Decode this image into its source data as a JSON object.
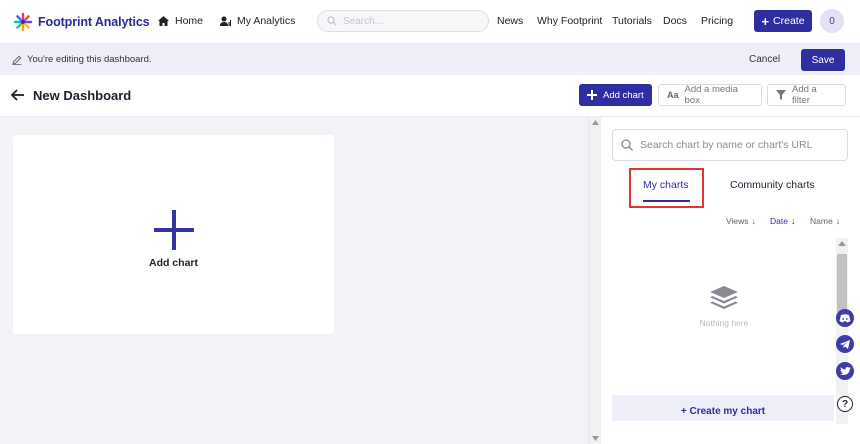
{
  "nav": {
    "brand": "Footprint Analytics",
    "home": "Home",
    "my_analytics": "My Analytics",
    "search_placeholder": "Search...",
    "links": [
      "News",
      "Why Footprint",
      "Tutorials",
      "Docs",
      "Pricing"
    ],
    "create": "Create",
    "avatar_initial": "0"
  },
  "banner": {
    "text": "You're editing this dashboard.",
    "cancel": "Cancel",
    "save": "Save"
  },
  "titlebar": {
    "title": "New Dashboard",
    "add_chart": "Add chart",
    "add_media": "Add a media box",
    "add_filter": "Add a filter"
  },
  "canvas": {
    "add_chart_label": "Add chart"
  },
  "panel": {
    "search_placeholder": "Search chart by name or chart's URL",
    "tabs": [
      "My charts",
      "Community charts"
    ],
    "active_tab": "My charts",
    "sort": [
      "Views",
      "Date",
      "Name"
    ],
    "active_sort": "Date",
    "empty_text": "Nothing here",
    "create_mine": "+ Create my chart"
  },
  "colors": {
    "primary": "#2f2ea0",
    "highlight": "#e53333",
    "discord": "#3e3ca8",
    "telegram": "#3e3ca8",
    "twitter": "#3e3ca8"
  }
}
